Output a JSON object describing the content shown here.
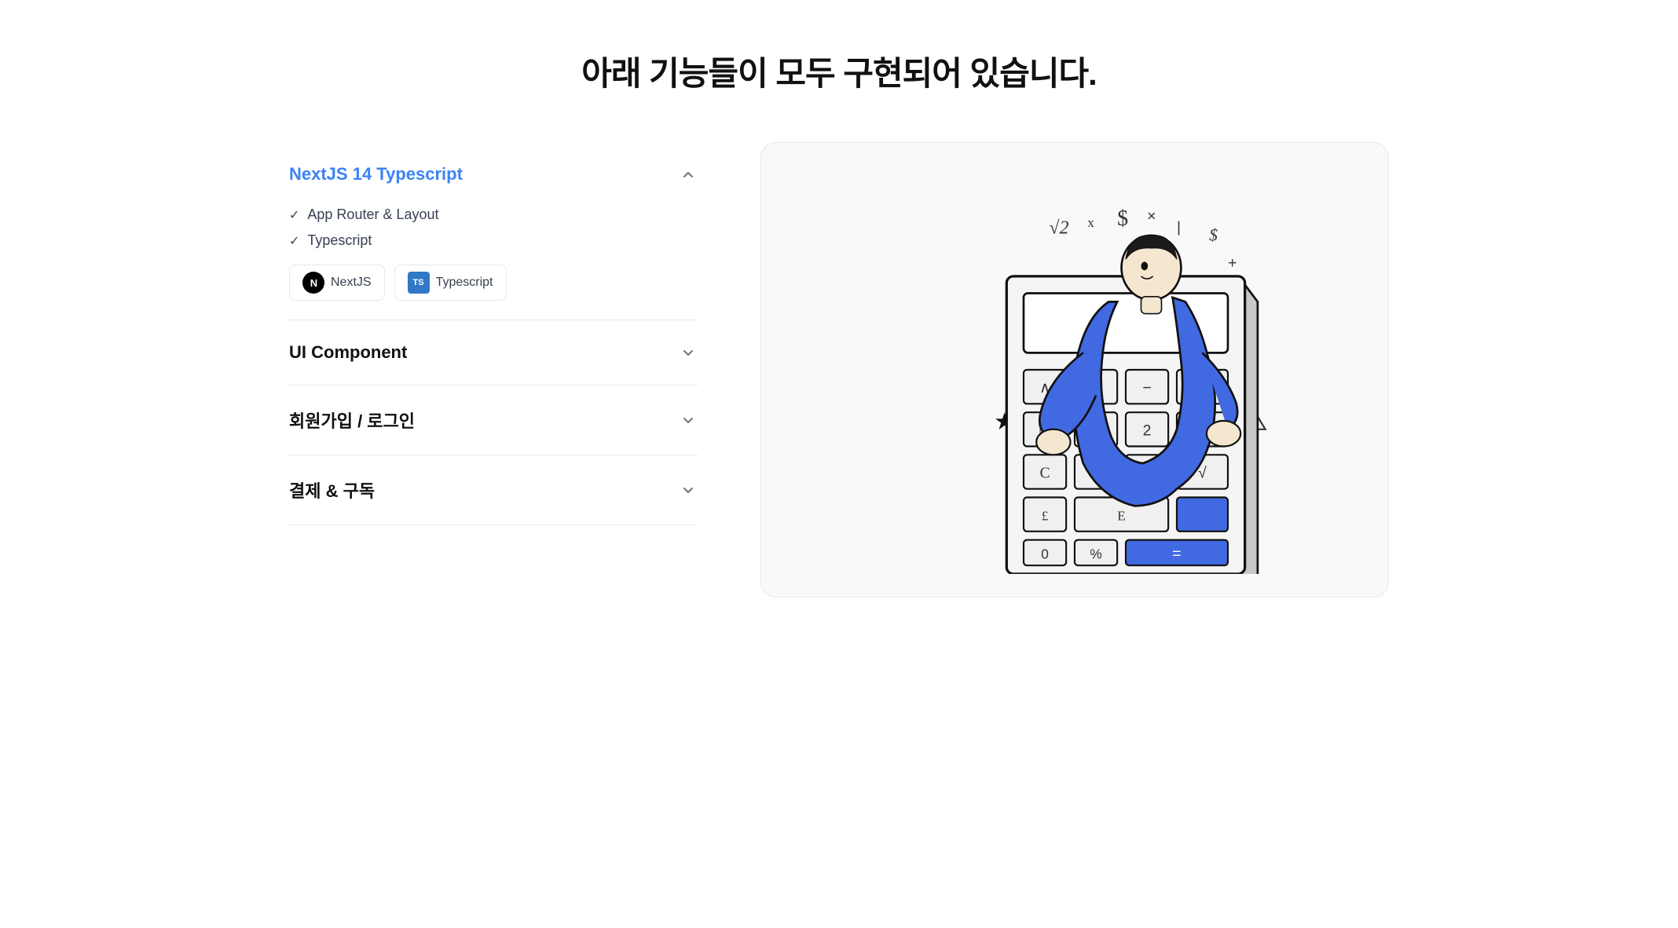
{
  "page": {
    "title": "아래 기능들이 모두 구현되어 있습니다."
  },
  "accordion": {
    "items": [
      {
        "id": "nextjs",
        "title": "NextJS 14 Typescript",
        "is_active": true,
        "check_items": [
          "App Router & Layout",
          "Typescript"
        ],
        "badges": [
          {
            "id": "nextjs",
            "label": "NextJS",
            "type": "nextjs"
          },
          {
            "id": "ts",
            "label": "Typescript",
            "type": "ts"
          }
        ]
      },
      {
        "id": "ui",
        "title": "UI Component",
        "is_active": false,
        "check_items": [],
        "badges": []
      },
      {
        "id": "auth",
        "title": "회원가입 / 로그인",
        "is_active": false,
        "check_items": [],
        "badges": []
      },
      {
        "id": "payment",
        "title": "결제 & 구독",
        "is_active": false,
        "check_items": [],
        "badges": []
      }
    ]
  }
}
